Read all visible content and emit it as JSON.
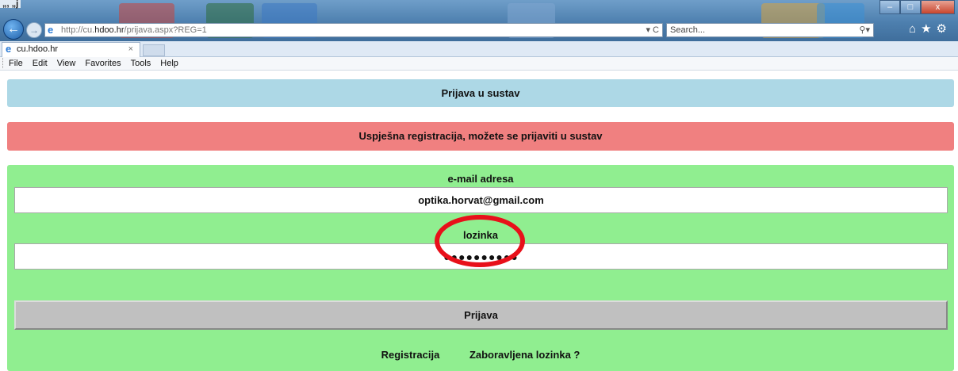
{
  "browser": {
    "window_title_fragment": "„,  „j",
    "address": {
      "scheme": "http://cu.",
      "host": "hdoo.hr",
      "path": "/prijava.aspx?REG=1",
      "tools": "▾ C"
    },
    "search_placeholder": "Search...",
    "search_icon": "magnifier-icon",
    "window_controls": [
      "–",
      "□",
      "x"
    ],
    "right_icons": "⌂★⚙",
    "tab": {
      "label": "cu.hdoo.hr",
      "close": "×"
    },
    "menu": [
      "File",
      "Edit",
      "View",
      "Favorites",
      "Tools",
      "Help"
    ]
  },
  "page": {
    "title": "Prijava u sustav",
    "message": "Uspješna registracija, možete se prijaviti u sustav",
    "email_label": "e-mail adresa",
    "email_value": "optika.horvat@gmail.com",
    "password_label": "lozinka",
    "password_value": "●●●●●●●●●●",
    "login_button": "Prijava",
    "register_link": "Registracija",
    "forgot_link": "Zaboravljena lozinka ?"
  },
  "colors": {
    "title_bar": "#add8e6",
    "message_bar": "#f08080",
    "form_panel": "#90ee90",
    "button": "#c0c0c0",
    "highlight": "#e8101a"
  }
}
